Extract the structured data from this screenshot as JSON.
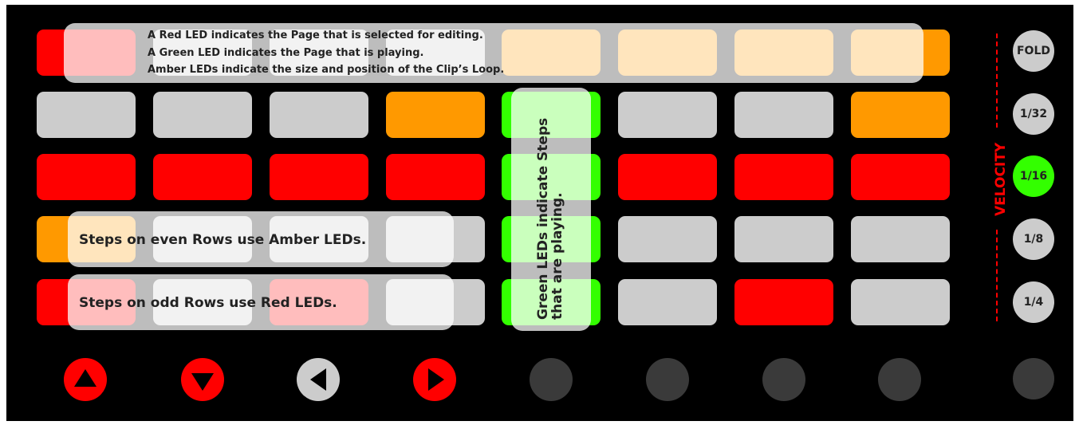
{
  "colors": {
    "red": "#ff0000",
    "amber": "#ff9900",
    "grey": "#cccccc",
    "green": "#33ff00",
    "dark": "#3a3a3a",
    "background": "#000000"
  },
  "grid": {
    "rows": [
      [
        "red",
        "grey",
        "grey",
        "grey",
        "amber",
        "amber",
        "amber",
        "amber"
      ],
      [
        "grey",
        "grey",
        "grey",
        "amber",
        "green",
        "grey",
        "grey",
        "amber"
      ],
      [
        "red",
        "red",
        "red",
        "red",
        "green",
        "red",
        "red",
        "red"
      ],
      [
        "amber",
        "grey",
        "grey",
        "grey",
        "green",
        "grey",
        "grey",
        "grey"
      ],
      [
        "red",
        "grey",
        "red",
        "grey",
        "green",
        "grey",
        "red",
        "grey"
      ]
    ]
  },
  "side_buttons": [
    {
      "label": "FOLD",
      "state": "grey"
    },
    {
      "label": "1/32",
      "state": "grey"
    },
    {
      "label": "1/16",
      "state": "green"
    },
    {
      "label": "1/8",
      "state": "grey"
    },
    {
      "label": "1/4",
      "state": "grey"
    },
    {
      "label": "",
      "state": "dark"
    }
  ],
  "velocity_label": "VELOCITY",
  "bottom_buttons": [
    {
      "icon": "arrow-up-icon",
      "color": "red"
    },
    {
      "icon": "arrow-down-icon",
      "color": "red"
    },
    {
      "icon": "arrow-left-icon",
      "color": "grey"
    },
    {
      "icon": "arrow-right-icon",
      "color": "red"
    },
    {
      "icon": "",
      "color": "dark"
    },
    {
      "icon": "",
      "color": "dark"
    },
    {
      "icon": "",
      "color": "dark"
    },
    {
      "icon": "",
      "color": "dark"
    }
  ],
  "annotations": {
    "top": [
      "A Red LED indicates the Page that is selected for editing.",
      "A Green LED indicates the Page that is playing.",
      "Amber LEDs indicate the size and position of the Clip’s Loop."
    ],
    "even_rows": "Steps on even Rows use Amber LEDs.",
    "odd_rows": "Steps on odd Rows use Red LEDs.",
    "green_steps": [
      "Green LEDs indicate Steps",
      "that are playing."
    ]
  }
}
